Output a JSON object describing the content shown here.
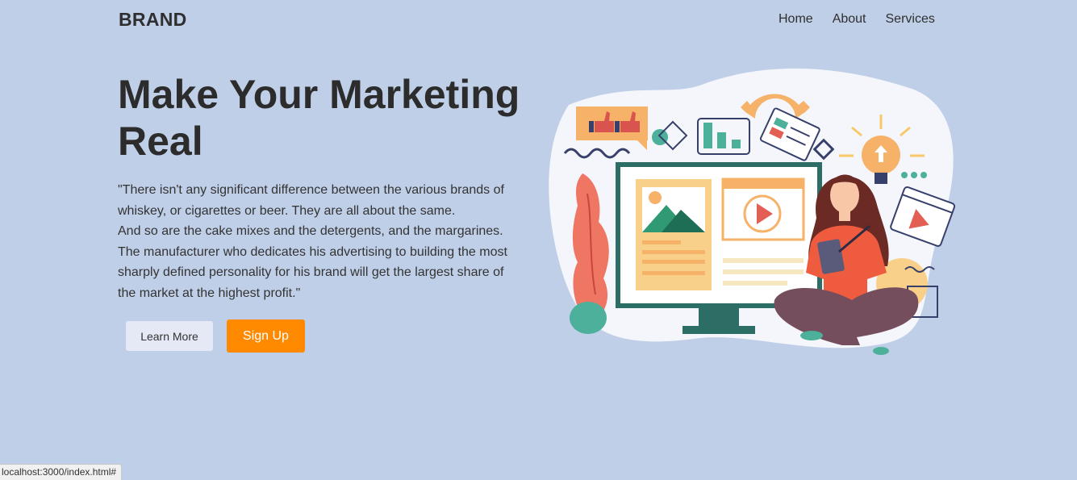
{
  "header": {
    "brand": "BRAND",
    "nav": [
      "Home",
      "About",
      "Services"
    ]
  },
  "hero": {
    "title": "Make Your Marketing Real",
    "quote_lines": [
      "\"There isn't any significant difference between the various brands of",
      "whiskey, or cigarettes or beer. They are all about the same.",
      "And so are the cake mixes and the detergents, and the margarines.",
      "The manufacturer who dedicates his advertising to building the most",
      "sharply defined personality for his brand will get the largest share of",
      "the market at the highest profit.\""
    ],
    "learn_more_label": "Learn More",
    "sign_up_label": "Sign Up"
  },
  "statusbar": {
    "url": "localhost:3000/index.html#"
  },
  "colors": {
    "background": "#c0cfe8",
    "accent": "#ff8a00",
    "secondary_button": "#e5e9f5",
    "text": "#2e2e2e"
  },
  "illustration": {
    "icon": "marketing-illustration"
  }
}
